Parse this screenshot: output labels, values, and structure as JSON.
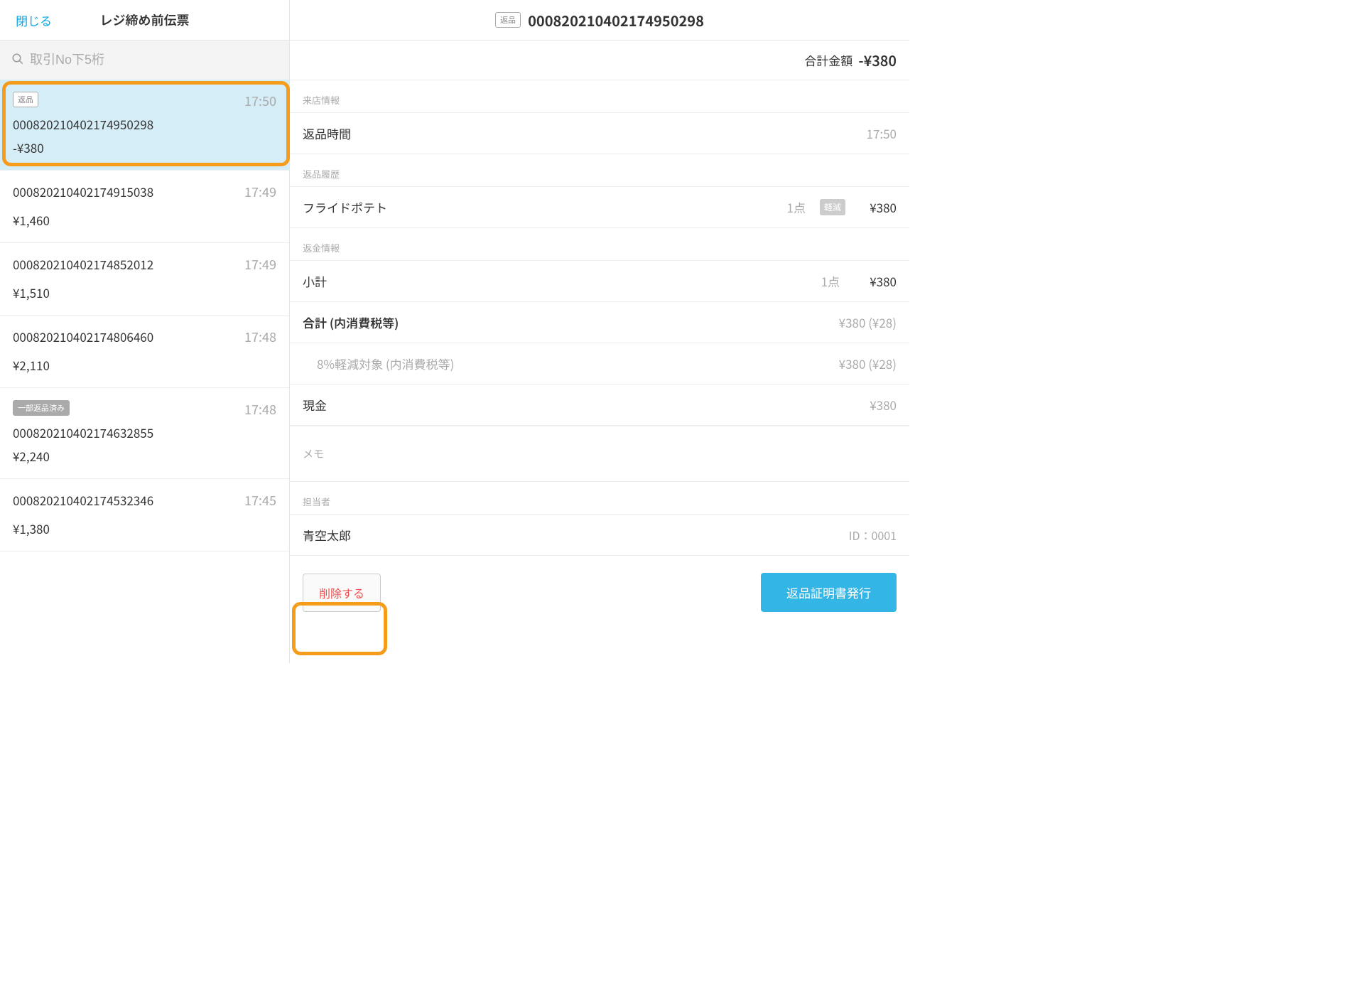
{
  "left": {
    "close": "閉じる",
    "title": "レジ締め前伝票",
    "search_placeholder": "取引No下5桁"
  },
  "transactions": [
    {
      "badge": "返品",
      "time": "17:50",
      "id": "000820210402174950298",
      "amount": "-¥380",
      "selected": true
    },
    {
      "badge": "",
      "time": "17:49",
      "id": "000820210402174915038",
      "amount": "¥1,460"
    },
    {
      "badge": "",
      "time": "17:49",
      "id": "000820210402174852012",
      "amount": "¥1,510"
    },
    {
      "badge": "",
      "time": "17:48",
      "id": "000820210402174806460",
      "amount": "¥2,110"
    },
    {
      "badge_fill": "一部返品済み",
      "time": "17:48",
      "id": "000820210402174632855",
      "amount": "¥2,240"
    },
    {
      "badge": "",
      "time": "17:45",
      "id": "000820210402174532346",
      "amount": "¥1,380"
    }
  ],
  "header": {
    "badge": "返品",
    "tx_id": "000820210402174950298"
  },
  "summary": {
    "label": "合計金額",
    "amount": "-¥380"
  },
  "visit": {
    "section": "来店情報",
    "return_time_label": "返品時間",
    "return_time": "17:50"
  },
  "history": {
    "section": "返品履歴",
    "item_name": "フライドポテト",
    "qty": "1点",
    "badge": "軽減",
    "price": "¥380"
  },
  "refund": {
    "section": "返金情報",
    "subtotal_label": "小計",
    "subtotal_qty": "1点",
    "subtotal_price": "¥380",
    "total_label": "合計 (内消費税等)",
    "total_price": "¥380 (¥28)",
    "tax_label": "8%軽減対象 (内消費税等)",
    "tax_price": "¥380 (¥28)",
    "cash_label": "現金",
    "cash_price": "¥380"
  },
  "memo": {
    "label": "メモ"
  },
  "staff": {
    "section": "担当者",
    "name": "青空太郎",
    "id": "ID：0001"
  },
  "buttons": {
    "delete": "削除する",
    "issue": "返品証明書発行"
  }
}
